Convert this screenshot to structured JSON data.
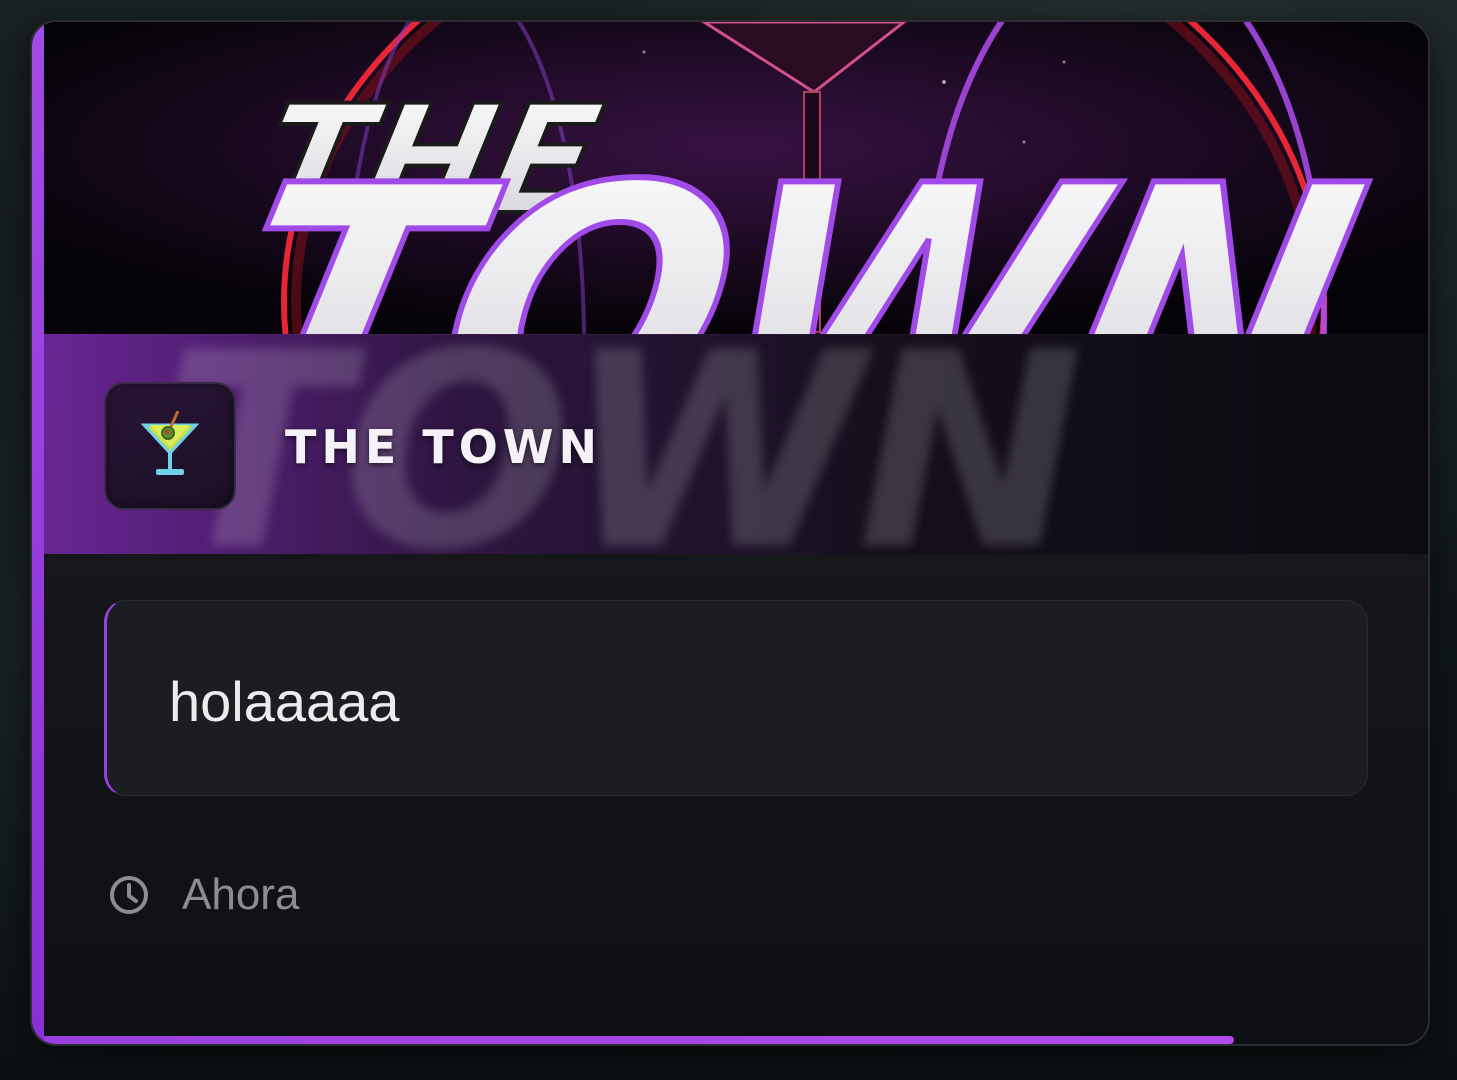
{
  "notification": {
    "app_name": "THE TOWN",
    "banner_text_top": "THE",
    "banner_text_bottom": "TOWN",
    "app_icon": "cocktail-glass-icon",
    "message": "holaaaaa",
    "time_icon": "clock-icon",
    "time_label": "Ahora",
    "progress": 0.86,
    "accent_color": "#9b3fe0"
  }
}
